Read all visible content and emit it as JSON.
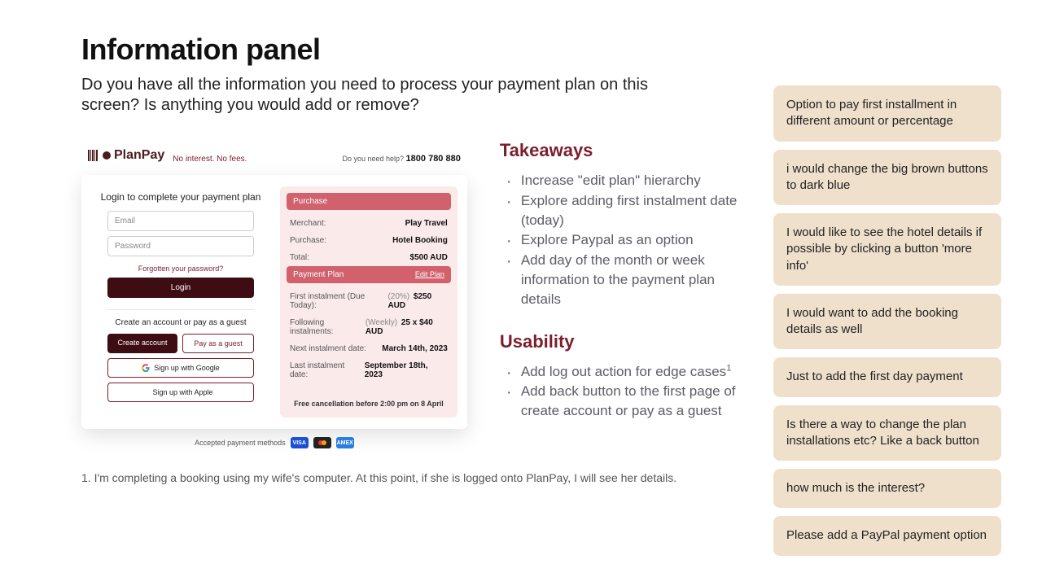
{
  "title": "Information panel",
  "subtitle": "Do you have all the information you need to process your payment plan on this screen? Is anything you would add or remove?",
  "takeaways": {
    "heading": "Takeaways",
    "items": [
      "Increase \"edit plan\" hierarchy",
      "Explore adding first instalment date (today)",
      "Explore Paypal as an option",
      "Add day of the month or week information to the payment plan details"
    ]
  },
  "usability": {
    "heading": "Usability",
    "items": [
      "Add log out action for edge cases",
      "Add back button to the first page of create account or pay as a guest"
    ],
    "item0_sup": "1"
  },
  "footnote": "1. I'm completing a booking using my wife's computer. At this point, if she is logged onto PlanPay, I will see her details.",
  "feedback": [
    "Option to pay first installment in different amount or percentage",
    "i would change the big brown buttons to dark blue",
    "I would like to see the hotel details if possible by clicking a button 'more info'",
    "I would want to add the booking details as well",
    "Just to add the first day payment",
    "Is there a way to change the plan installations etc? Like a back button",
    "how much is the interest?",
    "Please add a PayPal payment option"
  ],
  "mock": {
    "brand": "PlanPay",
    "tagline": "No interest. No fees.",
    "help_prefix": "Do you need help?",
    "help_phone": "1800 780 880",
    "login_title": "Login to complete your payment plan",
    "email_placeholder": "Email",
    "password_placeholder": "Password",
    "forgot": "Forgotten your password?",
    "login_btn": "Login",
    "create_title": "Create an account or pay as a guest",
    "create_btn": "Create account",
    "guest_btn": "Pay as a guest",
    "google_btn": "Sign up with Google",
    "apple_btn": "Sign up with Apple",
    "pay_methods_label": "Accepted payment methods",
    "purchase_header": "Purchase",
    "rows_purchase": {
      "merchant_k": "Merchant:",
      "merchant_v": "Play Travel",
      "purchase_k": "Purchase:",
      "purchase_v": "Hotel Booking",
      "total_k": "Total:",
      "total_v": "$500 AUD"
    },
    "plan_header": "Payment Plan",
    "edit_label": "Edit Plan",
    "rows_plan": {
      "first_k": "First instalment (Due Today):",
      "first_pct": "(20%)",
      "first_v": "$250 AUD",
      "follow_k": "Following instalments:",
      "follow_pre": "(Weekly)",
      "follow_v": "25 x $40 AUD",
      "next_k": "Next instalment date:",
      "next_v": "March 14th, 2023",
      "last_k": "Last instalment date:",
      "last_v": "September 18th, 2023"
    },
    "cancel_note": "Free cancellation before 2:00 pm on 8 April"
  }
}
